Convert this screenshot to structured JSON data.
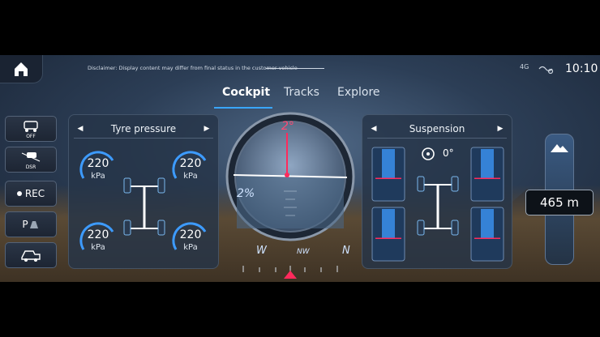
{
  "header": {
    "disclaimer": "Disclaimer: Display content may differ from final status in the customer vehicle",
    "network": "4G",
    "time": "10:10"
  },
  "tabs": [
    {
      "label": "Cockpit",
      "active": true
    },
    {
      "label": "Tracks",
      "active": false
    },
    {
      "label": "Explore",
      "active": false
    }
  ],
  "sidebar": {
    "items": [
      {
        "label": "OFF",
        "icon": "offroad-vehicle-icon"
      },
      {
        "label": "DSR",
        "icon": "downhill-speed-icon"
      },
      {
        "label": "REC",
        "icon": "record-dot-icon"
      },
      {
        "label": "P",
        "icon": "parking-camera-icon"
      },
      {
        "label": "",
        "icon": "trailer-camera-icon"
      }
    ]
  },
  "tyre_panel": {
    "title": "Tyre pressure",
    "tyres": [
      {
        "pos": "front-left",
        "value": "220",
        "unit": "kPa"
      },
      {
        "pos": "front-right",
        "value": "220",
        "unit": "kPa"
      },
      {
        "pos": "rear-left",
        "value": "220",
        "unit": "kPa"
      },
      {
        "pos": "rear-right",
        "value": "220",
        "unit": "kPa"
      }
    ]
  },
  "inclinometer": {
    "pitch": "2°",
    "roll": "2%",
    "compass": [
      "W",
      "NW",
      "N"
    ]
  },
  "suspension_panel": {
    "title": "Suspension",
    "steering_angle": "0°",
    "levels": [
      0.45,
      0.45,
      0.45,
      0.45
    ]
  },
  "altitude": {
    "value": "465 m"
  },
  "colors": {
    "accent": "#39a6ff",
    "warning_red": "#ff2a5c"
  }
}
